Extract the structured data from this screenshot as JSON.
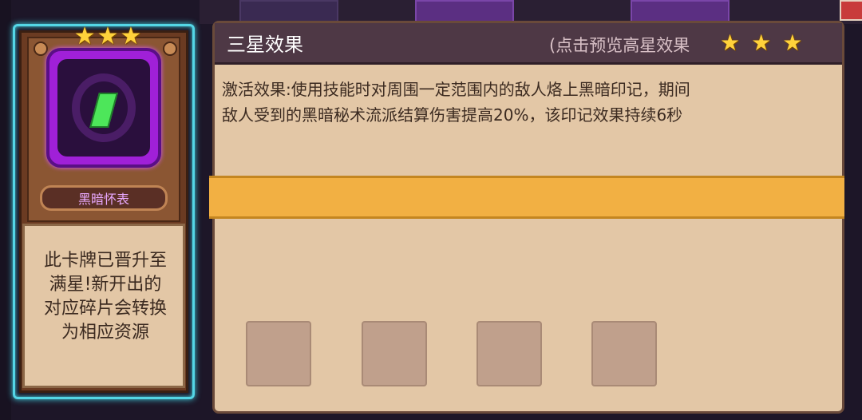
{
  "card": {
    "stars": [
      "★",
      "★",
      "★"
    ],
    "name": "黑暗怀表",
    "description_lines": [
      "此卡牌已晋升至",
      "满星!新开出的",
      "对应碎片会转换",
      "为相应资源"
    ],
    "icon": "dark-pocket-watch-icon",
    "glow_color": "#54d6e6"
  },
  "panel": {
    "title": "三星效果",
    "hint": "(点击预览高星效果",
    "hint_stars": [
      "★",
      "★",
      "★"
    ],
    "effect_lines": [
      "激活效果:使用技能时对周围一定范围内的敌人烙上黑暗印记，期间",
      "敌人受到的黑暗秘术流派结算伤害提高20%，该印记效果持续6秒"
    ],
    "slots": [
      "empty-slot",
      "empty-slot",
      "empty-slot",
      "empty-slot"
    ]
  },
  "colors": {
    "panel_bg": "#e3c7a6",
    "header_bg": "#4e3845",
    "highlight_bar": "#f2b043",
    "star": "#ffd23b"
  }
}
